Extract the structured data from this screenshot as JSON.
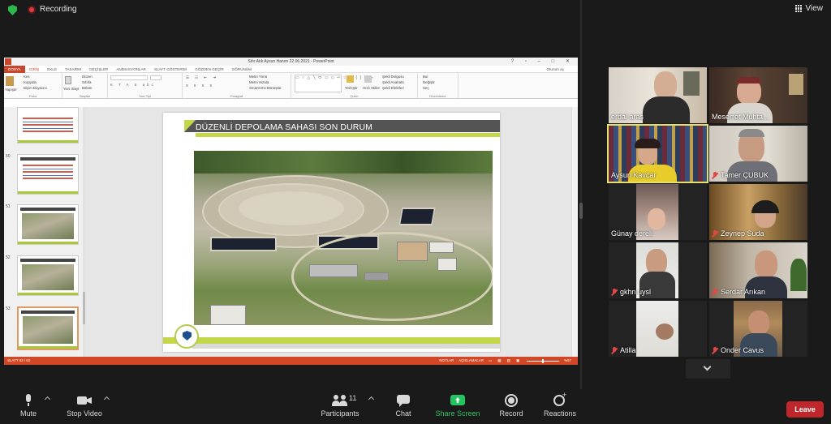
{
  "topbar": {
    "recording_label": "Recording",
    "view_label": "View"
  },
  "ppt": {
    "window_title": "Sıfır Atık Aysun Hanım 22.06.2021 - PowerPoint",
    "user": "Oturum aç",
    "tabs": [
      "DOSYA",
      "GİRİŞ",
      "EKLE",
      "TASARIM",
      "GEÇİŞLER",
      "ANİMASYONLAR",
      "SLAYT GÖSTERİSİ",
      "GÖZDEN GEÇİR",
      "GÖRÜNÜM"
    ],
    "ribbon": {
      "paste": "Yapıştır",
      "cut": "Kes",
      "copy": "Kopyala",
      "format_painter": "Biçim Boyacısı",
      "clipboard": "Pano",
      "new_slide": "Yeni Slayt",
      "layout": "Düzen",
      "reset": "Sıfırla",
      "section": "Bölüm",
      "slides": "Slaytlar",
      "font_group": "Yazı Tipi",
      "paragraph": "Paragraf",
      "text_direction": "Metin Yönü",
      "align_text": "Metni Hizala",
      "smartart": "SmartArt'a Dönüştür",
      "drawing": "Çizim",
      "arrange": "Yerleştir",
      "quick_styles": "Hızlı Stiller",
      "shape_fill": "Şekil Dolgusu",
      "shape_outline": "Şekil Anahattı",
      "shape_effects": "Şekil Efektleri",
      "find": "Bul",
      "replace": "Değiştir",
      "select": "Seç",
      "editing": "Düzenleme"
    },
    "thumb_numbers": [
      "50",
      "51",
      "52",
      "53"
    ],
    "slide_title": "DÜZENLİ DEPOLAMA SAHASI SON DURUM",
    "status_slide": "SLAYT 53 / 63",
    "status_notes": "NOTLAR",
    "status_comments": "AÇIKLAMALAR",
    "zoom": "%57"
  },
  "participants": [
    {
      "name": "erdal aras",
      "muted": false
    },
    {
      "name": "Meserret Muhta...",
      "muted": false
    },
    {
      "name": "Aysun Kavcar",
      "muted": false
    },
    {
      "name": "Tamer ÇUBUK",
      "muted": true
    },
    {
      "name": "Günay dereli",
      "muted": false
    },
    {
      "name": "Zeynep Suda",
      "muted": true
    },
    {
      "name": "gkhn uysl",
      "muted": true
    },
    {
      "name": "Serdar Arıkan",
      "muted": true
    },
    {
      "name": "Atilla",
      "muted": true
    },
    {
      "name": "Onder Cavus",
      "muted": true
    }
  ],
  "toolbar": {
    "mute": "Mute",
    "stop_video": "Stop Video",
    "participants": "Participants",
    "participants_count": "11",
    "chat": "Chat",
    "share_screen": "Share Screen",
    "record": "Record",
    "reactions": "Reactions",
    "leave": "Leave"
  },
  "colors": {
    "accent_green": "#23c55e",
    "leave_red": "#c0272d",
    "ppt_orange": "#d24726",
    "slide_lime": "#c4d64a",
    "active_speaker": "#e5e06a"
  }
}
